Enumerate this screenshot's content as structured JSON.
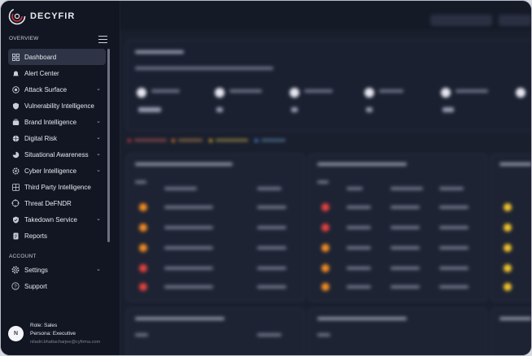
{
  "brand": {
    "name": "DECYFIR"
  },
  "sidebar": {
    "overview_label": "OVERVIEW",
    "items": [
      {
        "label": "Dashboard",
        "icon": "dashboard-icon",
        "chevron": false,
        "active": true
      },
      {
        "label": "Alert Center",
        "icon": "bell-icon",
        "chevron": false
      },
      {
        "label": "Attack Surface",
        "icon": "target-icon",
        "chevron": true
      },
      {
        "label": "Vulnerability Intelligence",
        "icon": "shield-icon",
        "chevron": false
      },
      {
        "label": "Brand Intelligence",
        "icon": "briefcase-icon",
        "chevron": true
      },
      {
        "label": "Digital Risk",
        "icon": "globe-icon",
        "chevron": true
      },
      {
        "label": "Situational Awareness",
        "icon": "radar-icon",
        "chevron": true
      },
      {
        "label": "Cyber Intelligence",
        "icon": "gear-icon",
        "chevron": true
      },
      {
        "label": "Third Party Intelligence",
        "icon": "grid-icon",
        "chevron": false
      },
      {
        "label": "Threat DeFNDR",
        "icon": "crosshair-icon",
        "chevron": false
      },
      {
        "label": "Takedown Service",
        "icon": "shield-check-icon",
        "chevron": true
      },
      {
        "label": "Reports",
        "icon": "document-icon",
        "chevron": false
      }
    ],
    "account_label": "ACCOUNT",
    "account_items": [
      {
        "label": "Settings",
        "icon": "settings-icon",
        "chevron": true
      },
      {
        "label": "Support",
        "icon": "help-icon",
        "chevron": false
      }
    ]
  },
  "user": {
    "initial": "N",
    "role": "Role: Sales",
    "persona": "Persona: Executive",
    "email": "niladri.bhattacharjee@cyfirma.com"
  },
  "colors": {
    "sidebar_bg": "#121622",
    "active_bg": "#2e3445",
    "main_bg": "#1a1f2e",
    "severity_high": "#f08a22",
    "severity_critical": "#e0413f",
    "severity_medium": "#f3c52b"
  }
}
